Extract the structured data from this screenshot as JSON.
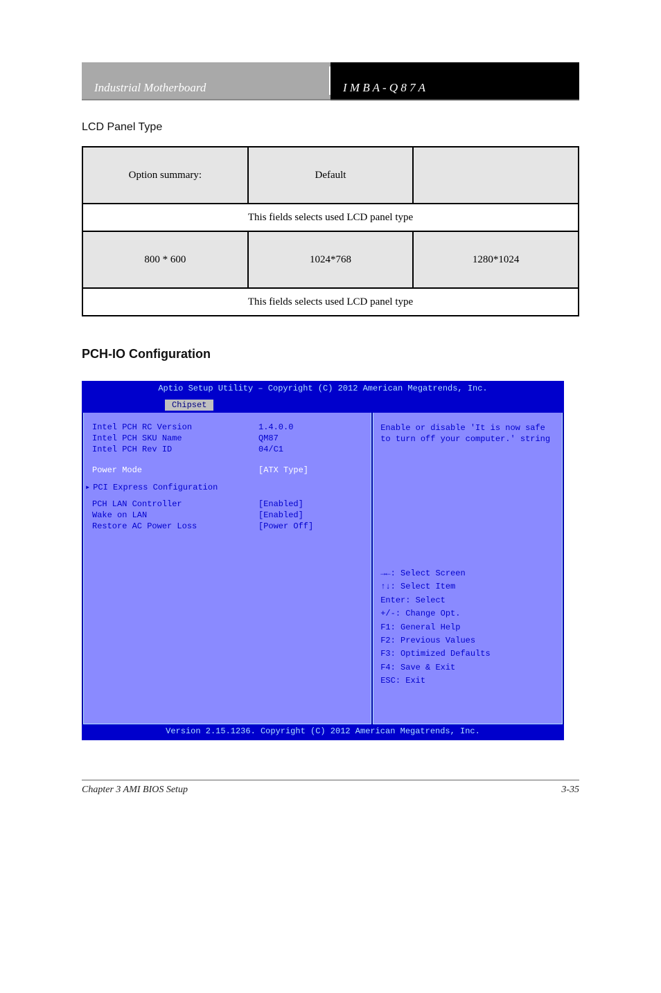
{
  "header": {
    "left": "Industrial Motherboard",
    "right": "I M B A - Q 8 7 A"
  },
  "section1_title": "LCD Panel Type",
  "table": {
    "row1": [
      "Option summary:",
      "Default",
      ""
    ],
    "row2_full": "This fields selects used LCD panel type",
    "row3": [
      "800 * 600",
      "1024*768",
      "1280*1024"
    ],
    "row4_full": "This fields selects used LCD panel type"
  },
  "bios_section_title": "PCH-IO Configuration",
  "bios": {
    "top": "Aptio Setup Utility – Copyright (C) 2012 American Megatrends, Inc.",
    "tab": "Chipset",
    "left_rows": [
      {
        "label": "Intel PCH RC Version",
        "value": "1.4.0.0"
      },
      {
        "label": "Intel PCH SKU Name",
        "value": "QM87"
      },
      {
        "label": "Intel PCH Rev ID",
        "value": "04/C1"
      }
    ],
    "power_mode": {
      "label": "Power Mode",
      "value": "[ATX Type]"
    },
    "submenu": "PCI Express Configuration",
    "lan_rows": [
      {
        "label": "PCH LAN Controller",
        "value": "[Enabled]"
      },
      {
        "label": "  Wake on LAN",
        "value": "[Enabled]"
      },
      {
        "label": "Restore AC Power Loss",
        "value": "[Power Off]"
      }
    ],
    "right_top": "Enable or disable 'It is now safe to turn off your computer.' string",
    "right_help": [
      "→←: Select Screen",
      "↑↓: Select Item",
      "Enter: Select",
      "+/-: Change Opt.",
      "F1: General Help",
      "F2: Previous Values",
      "F3: Optimized Defaults",
      "F4: Save & Exit",
      "ESC: Exit"
    ],
    "footer": "Version 2.15.1236. Copyright (C) 2012 American Megatrends, Inc."
  },
  "page_footer": {
    "left": "Chapter 3 AMI BIOS Setup",
    "right": "3-35"
  }
}
